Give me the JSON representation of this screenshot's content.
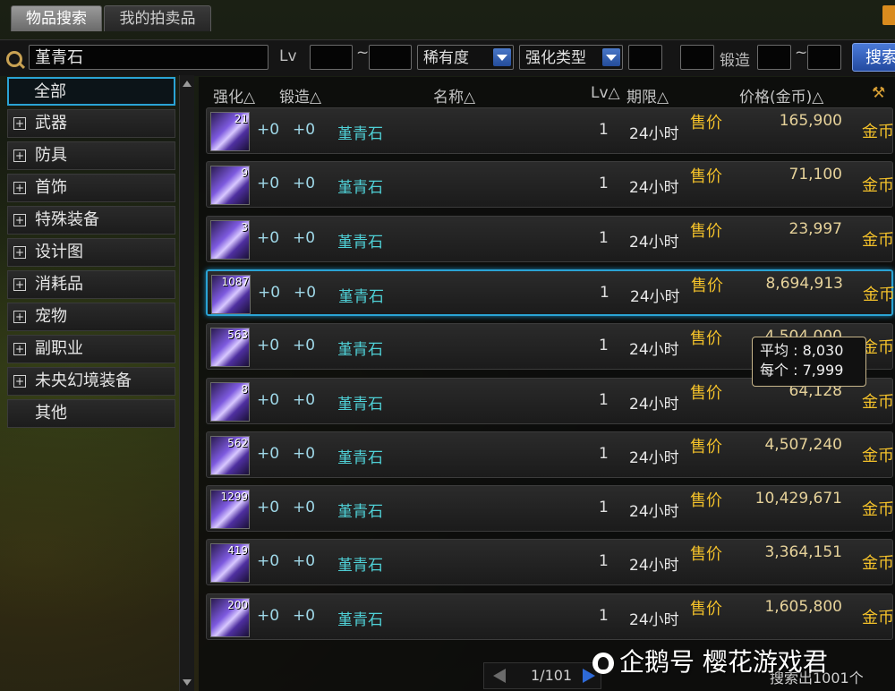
{
  "tabs": [
    {
      "label": "物品搜索"
    },
    {
      "label": "我的拍卖品"
    }
  ],
  "search": {
    "keyword": "堇青石",
    "lv_label": "Lv",
    "tilde": "~",
    "rarity_label": "稀有度",
    "enhance_label": "强化类型",
    "forge_label": "锻造",
    "button": "搜索"
  },
  "sidebar": {
    "items": [
      {
        "label": "全部",
        "expandable": false
      },
      {
        "label": "武器",
        "expandable": true
      },
      {
        "label": "防具",
        "expandable": true
      },
      {
        "label": "首饰",
        "expandable": true
      },
      {
        "label": "特殊装备",
        "expandable": true
      },
      {
        "label": "设计图",
        "expandable": true
      },
      {
        "label": "消耗品",
        "expandable": true
      },
      {
        "label": "宠物",
        "expandable": true
      },
      {
        "label": "副职业",
        "expandable": true
      },
      {
        "label": "未央幻境装备",
        "expandable": true
      },
      {
        "label": "其他",
        "expandable": false
      }
    ]
  },
  "columns": [
    "强化△",
    "锻造△",
    "名称△",
    "Lv△",
    "期限△",
    "价格(金币)△"
  ],
  "rows": [
    {
      "count": "21",
      "enhance": "+0",
      "forge": "+0",
      "name": "堇青石",
      "lv": "1",
      "period": "24小时",
      "sale": "售价",
      "price": "165,900",
      "currency": "金币"
    },
    {
      "count": "9",
      "enhance": "+0",
      "forge": "+0",
      "name": "堇青石",
      "lv": "1",
      "period": "24小时",
      "sale": "售价",
      "price": "71,100",
      "currency": "金币"
    },
    {
      "count": "3",
      "enhance": "+0",
      "forge": "+0",
      "name": "堇青石",
      "lv": "1",
      "period": "24小时",
      "sale": "售价",
      "price": "23,997",
      "currency": "金币"
    },
    {
      "count": "1087",
      "enhance": "+0",
      "forge": "+0",
      "name": "堇青石",
      "lv": "1",
      "period": "24小时",
      "sale": "售价",
      "price": "8,694,913",
      "currency": "金币"
    },
    {
      "count": "563",
      "enhance": "+0",
      "forge": "+0",
      "name": "堇青石",
      "lv": "1",
      "period": "24小时",
      "sale": "售价",
      "price": "4,504,000",
      "currency": "金币"
    },
    {
      "count": "8",
      "enhance": "+0",
      "forge": "+0",
      "name": "堇青石",
      "lv": "1",
      "period": "24小时",
      "sale": "售价",
      "price": "64,128",
      "currency": "金币"
    },
    {
      "count": "562",
      "enhance": "+0",
      "forge": "+0",
      "name": "堇青石",
      "lv": "1",
      "period": "24小时",
      "sale": "售价",
      "price": "4,507,240",
      "currency": "金币"
    },
    {
      "count": "1299",
      "enhance": "+0",
      "forge": "+0",
      "name": "堇青石",
      "lv": "1",
      "period": "24小时",
      "sale": "售价",
      "price": "10,429,671",
      "currency": "金币"
    },
    {
      "count": "419",
      "enhance": "+0",
      "forge": "+0",
      "name": "堇青石",
      "lv": "1",
      "period": "24小时",
      "sale": "售价",
      "price": "3,364,151",
      "currency": "金币"
    },
    {
      "count": "200",
      "enhance": "+0",
      "forge": "+0",
      "name": "堇青石",
      "lv": "1",
      "period": "24小时",
      "sale": "售价",
      "price": "1,605,800",
      "currency": "金币"
    }
  ],
  "tooltip": {
    "line1": "平均 : 8,030",
    "line2": "每个 : 7,999"
  },
  "pager": {
    "text": "1/101"
  },
  "footer": {
    "count_text": "搜索出1001个"
  },
  "watermark": {
    "text": "企鹅号 樱花游戏君"
  },
  "colors": {
    "accent": "#2aa3d4",
    "gold": "#f3c12a",
    "name": "#4fd0d6"
  }
}
